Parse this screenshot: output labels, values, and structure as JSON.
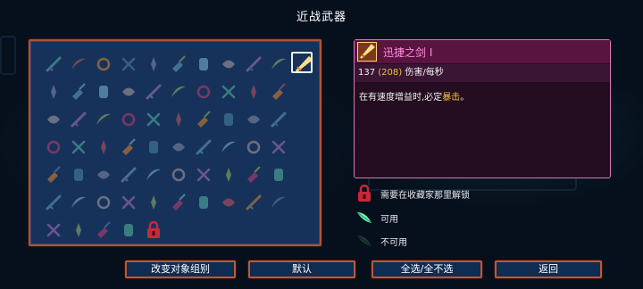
{
  "screen": {
    "title": "近战武器"
  },
  "weapon_grid": {
    "selected_index": 10,
    "rows": [
      [
        "leaf-blade-icon",
        "knife-icon",
        "curved-sword-icon",
        "sickle-icon",
        "cross-swords-icon",
        "green-blade-icon",
        "shovel-icon",
        "twin-daggers-icon",
        "dagger-icon",
        "feather-blade-icon",
        "golden-sword-icon"
      ],
      [
        "axe-icon",
        "scythe-icon",
        "hammer-icon",
        "claw-icon",
        "spear-icon",
        "sword-icon",
        "broad-blade-icon",
        "whip-icon",
        "purple-scythe-icon",
        "boot-icon"
      ],
      [
        "glove-icon",
        "blade-icon",
        "bell-icon",
        "chain-icon",
        "purple-sickle-icon",
        "orb-icon",
        "cleaver-icon",
        "rapier-icon",
        "gauntlet-icon",
        "shuriken-icon"
      ],
      [
        "hook-icon",
        "ring-icon",
        "gear-icon",
        "lantern-icon",
        "bomb-icon",
        "torch-icon",
        "horn-icon",
        "rod-icon",
        "staff-icon",
        "boomerang-icon"
      ],
      [
        "flask-icon",
        "mace-icon",
        "club-icon",
        "crossed-blades-icon",
        "spiked-sword-icon",
        "wand-icon",
        "bone-icon",
        "trident-icon",
        "hook-blade-icon",
        "broadsword-icon"
      ],
      [
        "crescent-icon",
        "shield-icon",
        "great-sword-icon",
        "twin-sabres-icon",
        "pickaxe-icon",
        "mallet-icon",
        "bat-icon",
        "ring-blade-icon",
        "nunchaku-icon",
        "longsword-icon"
      ],
      [
        "chest-icon",
        "thin-blade-icon",
        "whip-blade-icon",
        "bow-blade-icon",
        "red-lock-icon"
      ]
    ]
  },
  "detail": {
    "name": "迅捷之剑 I",
    "dps_value": "137",
    "dps_boosted": "(208)",
    "dps_unit": "伤害/每秒",
    "desc_prefix": "在有速度增益时,必定",
    "desc_highlight": "暴击",
    "desc_suffix": "。"
  },
  "legend": {
    "locked": "需要在收藏家那里解锁",
    "available": "可用",
    "unavailable": "不可用"
  },
  "buttons": {
    "change_group": "改变对象组别",
    "default": "默认",
    "select_all": "全选/全不选",
    "back": "返回"
  },
  "colors": {
    "panel_bg": "#17325a",
    "panel_border": "#b0513a",
    "detail_border": "#d47ab4",
    "name_color": "#ff8fe0",
    "highlight": "#f2c23a"
  }
}
